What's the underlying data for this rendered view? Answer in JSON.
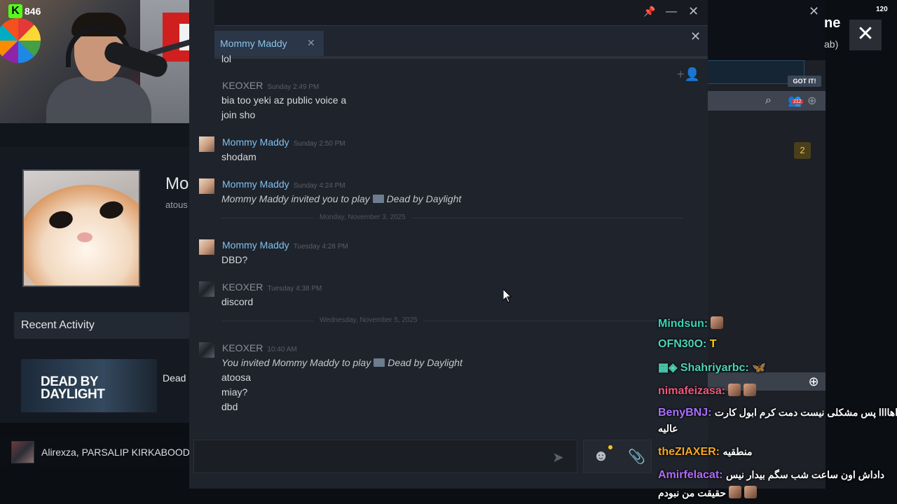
{
  "stream": {
    "viewer_count": "846",
    "kick_logo_letter": "K",
    "fps": "120"
  },
  "profile": {
    "name_partial": "Mo",
    "sub_partial": "atous",
    "recent_activity_label": "Recent Activity",
    "game_banner_line1": "DEAD BY",
    "game_banner_line2": "DAYLIGHT",
    "game_label_partial": "Dead"
  },
  "friends_bar": {
    "label": "Alirexza, PARSALIP KIRKABOOD,"
  },
  "chat_window": {
    "tab_label": "Mommy Maddy",
    "tab_close": "✕",
    "partial_top_line": "lol",
    "messages": [
      {
        "sender": "KEOXER",
        "time": "Sunday 2:49 PM",
        "lines": [
          "bia too yeki az public voice a",
          "join sho"
        ]
      },
      {
        "sender": "Mommy Maddy",
        "time": "Sunday 2:50 PM",
        "lines": [
          "shodam"
        ]
      },
      {
        "sender": "Mommy Maddy",
        "time": "Sunday 4:24 PM",
        "invite_prefix": "Mommy Maddy invited you to play",
        "invite_game": "Dead by Daylight"
      },
      {
        "sender": "Mommy Maddy",
        "time": "Tuesday 4:28 PM",
        "lines": [
          "DBD?"
        ]
      },
      {
        "sender": "KEOXER",
        "time": "Tuesday 4:38 PM",
        "lines": [
          "discord"
        ]
      },
      {
        "sender": "KEOXER",
        "time": "10:40 AM",
        "invite_prefix": "You invited Mommy Maddy to play",
        "invite_game": "Dead by Daylight",
        "lines": [
          "atoosa",
          "miay?",
          "dbd"
        ]
      }
    ],
    "dividers": [
      "Monday, November 3, 2025",
      "Wednesday, November 5, 2025"
    ]
  },
  "right_panel": {
    "title_partial": "ne",
    "sub_partial": "ab)",
    "gotit_label": "GOT IT!",
    "friends_badge": "212",
    "count_badge": "2"
  },
  "overlay_chat": [
    {
      "user": "Mindsun:",
      "color": "#3bd3b8",
      "msg": ""
    },
    {
      "user": "OFN30O:",
      "color": "#4fd3ba",
      "msg": "T"
    },
    {
      "user": "Shahriyarbc:",
      "color": "#4fd3ba",
      "msg": ""
    },
    {
      "user": "nimafeizasa:",
      "color": "#f05a7e",
      "msg": ""
    },
    {
      "user": "BenyBNJ:",
      "color": "#a970ff",
      "msg": "اهاااا پس مشکلی نیست دمت کرم ابول کارت",
      "msg2": "عالیه"
    },
    {
      "user": "theZIAXER:",
      "color": "#f5a623",
      "msg": "منطقیه"
    },
    {
      "user": "Amirfelacat:",
      "color": "#b06cf5",
      "msg": "داداش اون ساعت شب سگم بیدار نیس",
      "msg2": "حقیقت من نبودم"
    }
  ],
  "colors": {
    "accent": "#7fc1f0",
    "chat_bg": "#1f232b",
    "tab_bg": "#2b3648"
  }
}
